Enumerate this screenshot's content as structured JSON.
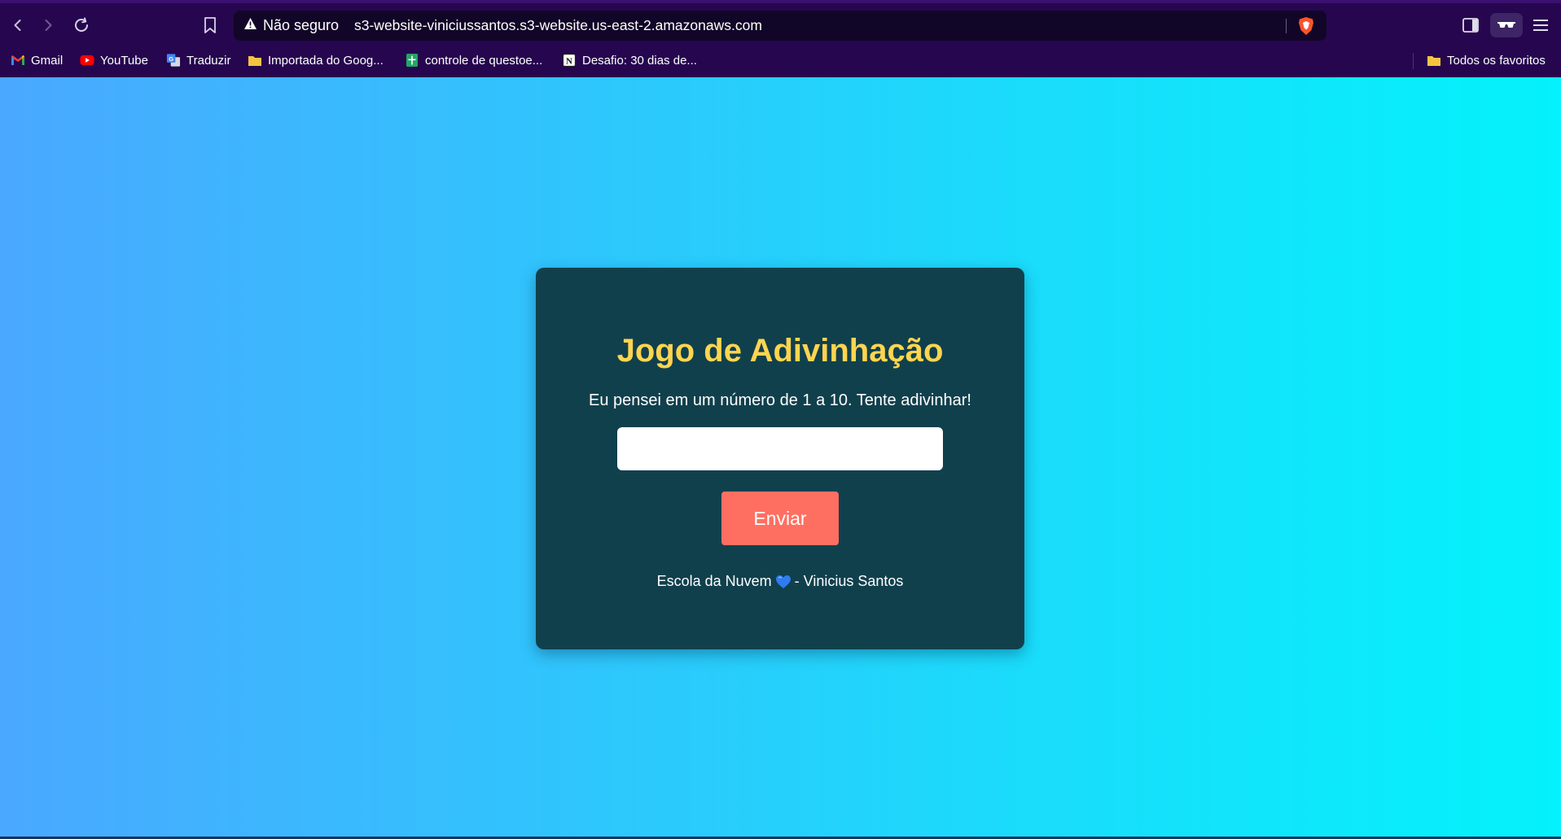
{
  "browser": {
    "security_label": "Não seguro",
    "url": "s3-website-viniciussantos.s3-website.us-east-2.amazonaws.com",
    "icons": {
      "back": "back-arrow-icon",
      "forward": "forward-arrow-icon",
      "reload": "reload-icon",
      "bookmark": "bookmark-icon",
      "warning": "warning-triangle-icon",
      "shield": "brave-shield-icon",
      "sidebar": "sidebar-toggle-icon",
      "wallet": "glasses-icon",
      "menu": "hamburger-menu-icon"
    },
    "bookmarks": [
      {
        "label": "Gmail",
        "icon": "gmail-icon"
      },
      {
        "label": "YouTube",
        "icon": "youtube-icon"
      },
      {
        "label": "Traduzir",
        "icon": "translate-icon"
      },
      {
        "label": "Importada do Goog...",
        "icon": "folder-icon"
      },
      {
        "label": "controle de questoe...",
        "icon": "sheets-icon"
      },
      {
        "label": "Desafio: 30 dias de...",
        "icon": "notion-icon"
      }
    ],
    "all_bookmarks": {
      "label": "Todos os favoritos",
      "icon": "folder-icon"
    }
  },
  "game": {
    "title": "Jogo de Adivinhação",
    "instructions": "Eu pensei em um número de 1 a 10. Tente adivinhar!",
    "input_value": "",
    "submit_label": "Enviar",
    "footer_left": "Escola da Nuvem",
    "footer_heart_icon": "blue-heart-icon",
    "footer_right": "- Vinicius Santos"
  },
  "colors": {
    "chrome_bg": "#26064f",
    "card_bg": "#11404d",
    "title": "#ffd54f",
    "button": "#ff6f61",
    "gradient_start": "#4aa8ff",
    "gradient_end": "#03f2fb"
  }
}
